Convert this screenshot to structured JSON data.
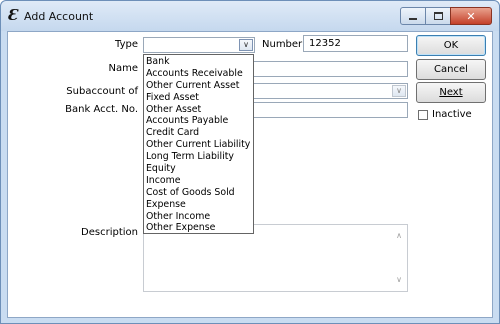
{
  "window": {
    "title": "Add Account",
    "app_icon_glyph": "Ɛ",
    "close_glyph": "✕"
  },
  "form": {
    "type_label": "Type",
    "type_value": "",
    "number_label": "Number",
    "number_value": "12352",
    "name_label": "Name",
    "subaccount_label": "Subaccount of",
    "bank_acct_label": "Bank Acct. No.",
    "description_label": "Description"
  },
  "buttons": {
    "ok": "OK",
    "cancel": "Cancel",
    "next": "Next"
  },
  "inactive": {
    "label": "Inactive",
    "checked": false
  },
  "type_dropdown": {
    "options": [
      "Bank",
      "Accounts Receivable",
      "Other Current Asset",
      "Fixed Asset",
      "Other Asset",
      "Accounts Payable",
      "Credit Card",
      "Other Current Liability",
      "Long Term Liability",
      "Equity",
      "Income",
      "Cost of Goods Sold",
      "Expense",
      "Other Income",
      "Other Expense"
    ]
  },
  "icons": {
    "combo_arrow": "∨",
    "scroll_up": "∧",
    "scroll_down": "∨"
  }
}
